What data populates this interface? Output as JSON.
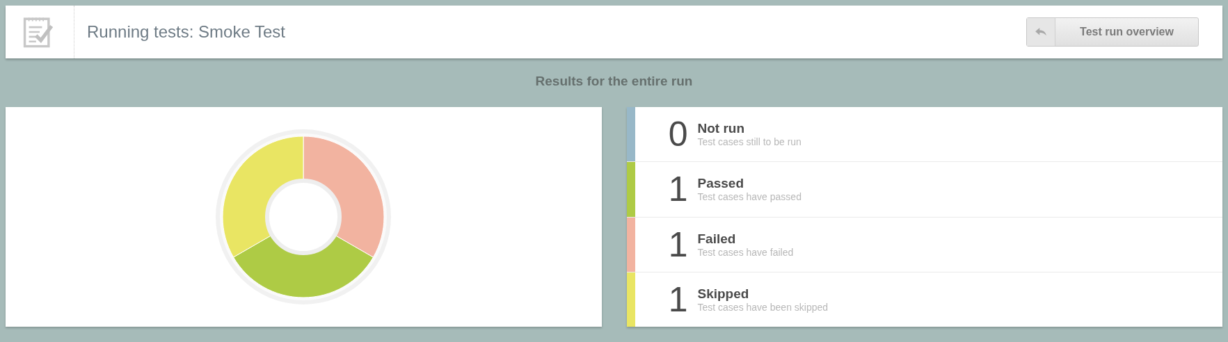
{
  "header": {
    "title": "Running tests: Smoke Test",
    "button": "Test run overview"
  },
  "subtitle": "Results for the entire run",
  "results": [
    {
      "count": "0",
      "label": "Not run",
      "description": "Test cases still to be run",
      "color": "#98b8c8"
    },
    {
      "count": "1",
      "label": "Passed",
      "description": "Test cases have passed",
      "color": "#aecb45"
    },
    {
      "count": "1",
      "label": "Failed",
      "description": "Test cases have failed",
      "color": "#f2b3a0"
    },
    {
      "count": "1",
      "label": "Skipped",
      "description": "Test cases have been skipped",
      "color": "#e9e563"
    }
  ]
}
